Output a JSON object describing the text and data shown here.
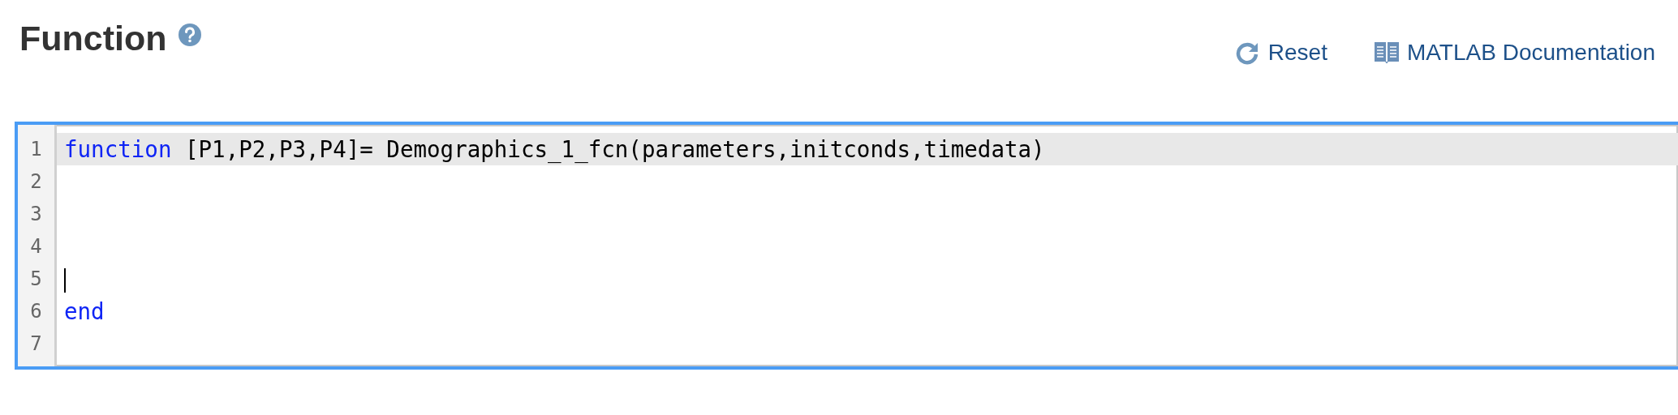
{
  "title": "Function",
  "actions": [
    {
      "label": "Reset",
      "kind": "reset"
    },
    {
      "label": "MATLAB Documentation",
      "kind": "docs"
    }
  ],
  "editor": {
    "focused": true,
    "lines": [
      {
        "number": "1",
        "highlighted": true,
        "cursor": false,
        "tokens": [
          {
            "kind": "keyword",
            "text": "function"
          },
          {
            "kind": "plain",
            "text": " [P1,P2,P3,P4]= Demographics_1_fcn(parameters,initconds,timedata)"
          }
        ]
      },
      {
        "number": "2",
        "highlighted": false,
        "cursor": false
      },
      {
        "number": "3",
        "highlighted": false,
        "cursor": false
      },
      {
        "number": "4",
        "highlighted": false,
        "cursor": false
      },
      {
        "number": "5",
        "highlighted": false,
        "cursor": true
      },
      {
        "number": "6",
        "highlighted": false,
        "cursor": false,
        "tokens": [
          {
            "kind": "keyword",
            "text": "end"
          }
        ]
      },
      {
        "number": "7",
        "highlighted": false,
        "cursor": false
      }
    ]
  }
}
